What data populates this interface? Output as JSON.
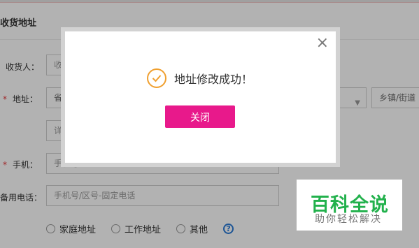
{
  "form": {
    "section_title": "收货地址",
    "receiver_label": "收货人：",
    "receiver_value": "收",
    "address_label": "地址：",
    "required_mark": "*",
    "province_text": "省",
    "town_text": "乡镇/街道",
    "detail_text": "详",
    "phone_label": "手机：",
    "phone_value": "手机号",
    "backup_phone_label": "备用电话：",
    "backup_phone_placeholder": "手机号/区号-固定电话",
    "radios": [
      "家庭地址",
      "工作地址",
      "其他"
    ],
    "help_symbol": "?"
  },
  "modal": {
    "message": "地址修改成功！",
    "close_button": "关闭",
    "close_symbol": "×"
  },
  "watermark": {
    "title": "百科全说",
    "subtitle": "助你轻松解决"
  },
  "colors": {
    "primary_button": "#e8198b",
    "success_icon": "#f0a030",
    "watermark_green": "#22b14c",
    "help_blue": "#2a7ad6"
  }
}
